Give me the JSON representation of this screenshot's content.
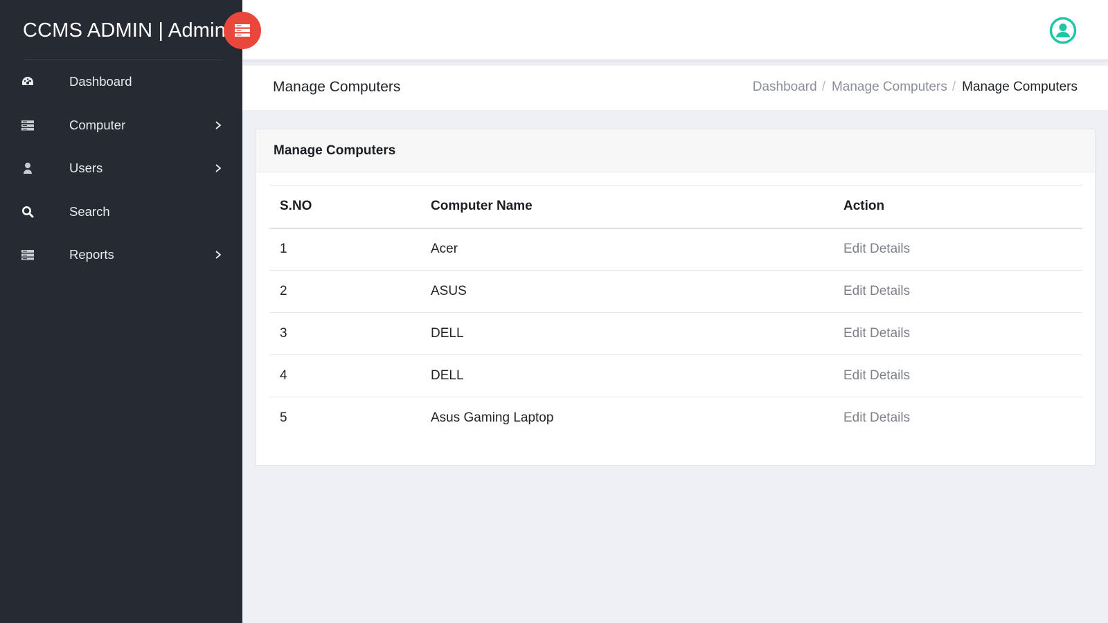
{
  "brand": {
    "title": "CCMS ADMIN | Admin",
    "toggle_icon": "menu-toggle-icon"
  },
  "sidebar": {
    "items": [
      {
        "label": "Dashboard",
        "icon": "dashboard-icon",
        "has_submenu": false
      },
      {
        "label": "Computer",
        "icon": "server-icon",
        "has_submenu": true
      },
      {
        "label": "Users",
        "icon": "user-icon",
        "has_submenu": true
      },
      {
        "label": "Search",
        "icon": "search-icon",
        "has_submenu": false
      },
      {
        "label": "Reports",
        "icon": "server-icon",
        "has_submenu": true
      }
    ]
  },
  "topbar": {
    "avatar_icon": "user-circle-icon",
    "accent": "#1fc7a7"
  },
  "page": {
    "title": "Manage Computers",
    "breadcrumb": [
      "Dashboard",
      "Manage Computers",
      "Manage Computers"
    ]
  },
  "card": {
    "title": "Manage Computers",
    "columns": [
      "S.NO",
      "Computer Name",
      "Action"
    ],
    "rows": [
      {
        "sno": "1",
        "name": "Acer",
        "action": "Edit Details"
      },
      {
        "sno": "2",
        "name": "ASUS",
        "action": "Edit Details"
      },
      {
        "sno": "3",
        "name": "DELL",
        "action": "Edit Details"
      },
      {
        "sno": "4",
        "name": "DELL",
        "action": "Edit Details"
      },
      {
        "sno": "5",
        "name": "Asus Gaming Laptop",
        "action": "Edit Details"
      }
    ]
  },
  "colors": {
    "sidebar_bg": "#262a33",
    "toggle_bg": "#e8483c",
    "page_bg": "#eef0f5"
  }
}
